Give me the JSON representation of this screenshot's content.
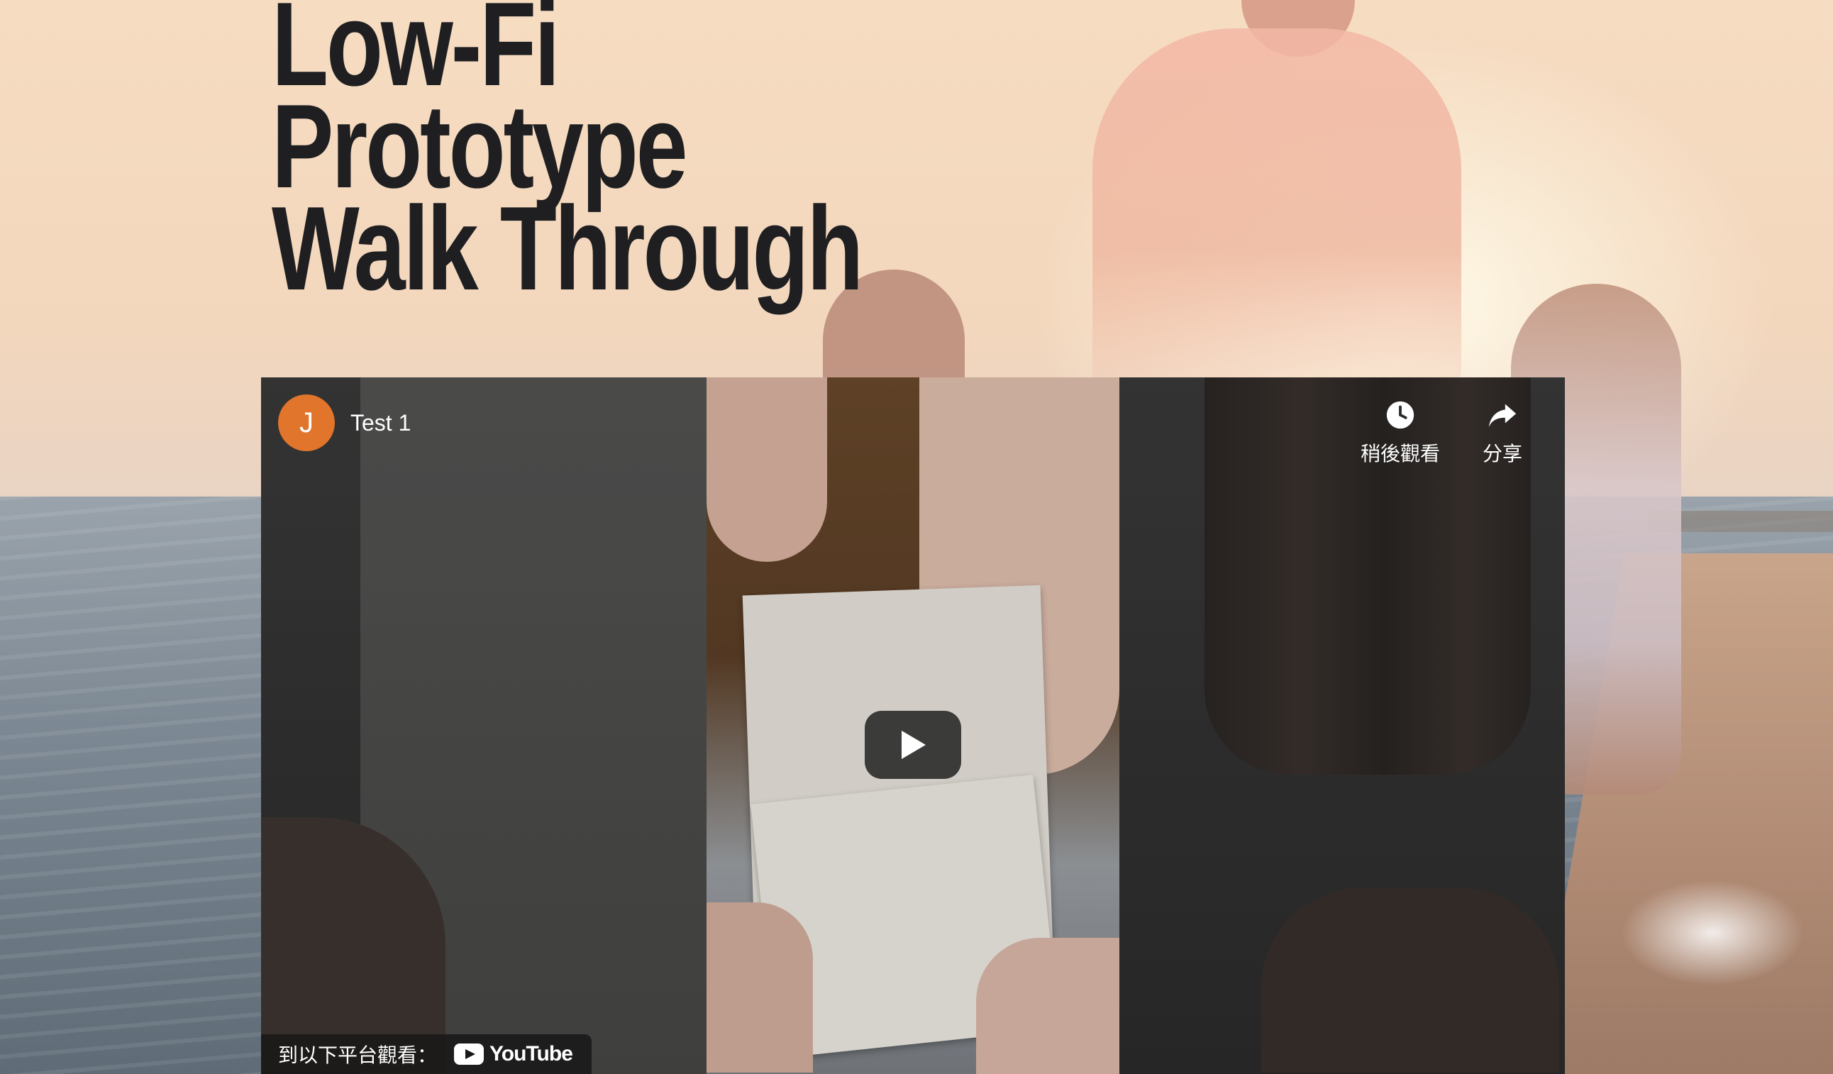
{
  "page": {
    "title_lines": [
      "Low-Fi",
      "Prototype",
      "Walk Through"
    ]
  },
  "video": {
    "channel_initial": "J",
    "title": "Test 1",
    "actions": [
      {
        "label": "稍後觀看",
        "icon": "clock-icon"
      },
      {
        "label": "分享",
        "icon": "share-icon"
      }
    ],
    "watch_on_label": "到以下平台觀看：",
    "platform": "YouTube"
  },
  "colors": {
    "avatar": "#e0752b",
    "title_text": "#1f1f22"
  }
}
